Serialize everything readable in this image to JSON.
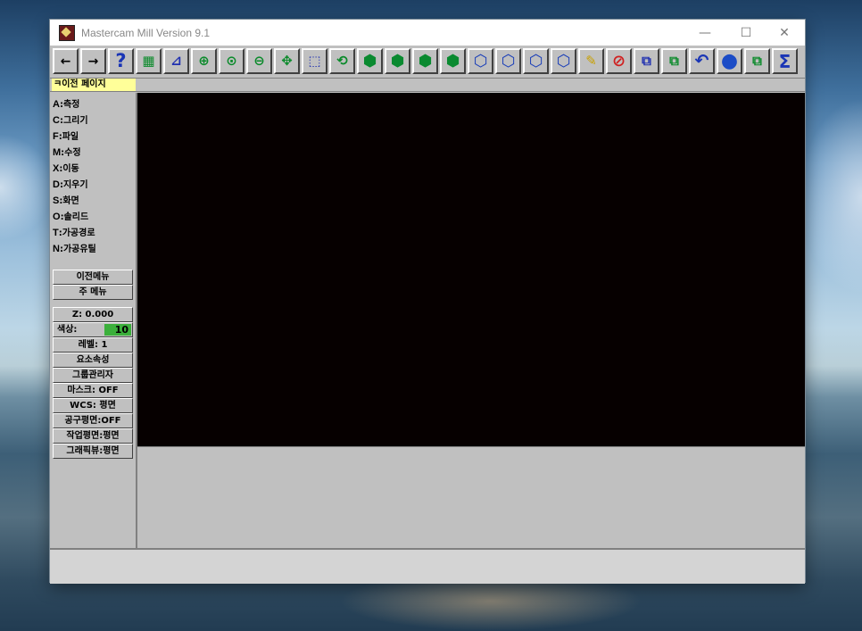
{
  "window": {
    "title": "Mastercam Mill Version 9.1"
  },
  "window_controls": {
    "minimize": "—",
    "maximize": "☐",
    "close": "✕"
  },
  "toolbar": {
    "buttons": [
      {
        "name": "back-arrow-icon",
        "glyph": "←"
      },
      {
        "name": "forward-arrow-icon",
        "glyph": "→"
      },
      {
        "name": "help-icon",
        "glyph": "?"
      },
      {
        "name": "calculator-icon",
        "glyph": "▦"
      },
      {
        "name": "analyze-icon",
        "glyph": "⊿"
      },
      {
        "name": "zoom-window-icon",
        "glyph": "⊕"
      },
      {
        "name": "zoom-in-icon",
        "glyph": "⊙"
      },
      {
        "name": "zoom-out-icon",
        "glyph": "⊖"
      },
      {
        "name": "pan-icon",
        "glyph": "✥"
      },
      {
        "name": "fit-screen-icon",
        "glyph": "⬚"
      },
      {
        "name": "rotate-view-icon",
        "glyph": "⟲"
      },
      {
        "name": "view-top-icon",
        "glyph": "⬢"
      },
      {
        "name": "view-front-icon",
        "glyph": "⬢"
      },
      {
        "name": "view-side-icon",
        "glyph": "⬢"
      },
      {
        "name": "view-iso-icon",
        "glyph": "⬢"
      },
      {
        "name": "cplane-top-icon",
        "glyph": "⬡"
      },
      {
        "name": "cplane-front-icon",
        "glyph": "⬡"
      },
      {
        "name": "cplane-side-icon",
        "glyph": "⬡"
      },
      {
        "name": "cplane-3d-icon",
        "glyph": "⬡"
      },
      {
        "name": "sketch-pencil-icon",
        "glyph": "✎"
      },
      {
        "name": "clear-color-icon",
        "glyph": "⊘"
      },
      {
        "name": "copy-view-icon",
        "glyph": "⧉"
      },
      {
        "name": "transform-icon",
        "glyph": "⧉"
      },
      {
        "name": "undo-icon",
        "glyph": "↶"
      },
      {
        "name": "shade-sphere-icon",
        "glyph": "●"
      },
      {
        "name": "layers-icon",
        "glyph": "⧉"
      },
      {
        "name": "sigma-icon",
        "glyph": "Σ"
      }
    ]
  },
  "prompt": {
    "text": "ㅋ이전 페이지"
  },
  "menu": {
    "items": [
      {
        "key": "A",
        "label": ":측정"
      },
      {
        "key": "C",
        "label": ":그리기"
      },
      {
        "key": "F",
        "label": ":파일"
      },
      {
        "key": "M",
        "label": ":수정"
      },
      {
        "key": "X",
        "label": ":이동"
      },
      {
        "key": "D",
        "label": ":지우기"
      },
      {
        "key": "S",
        "label": ":화면"
      },
      {
        "key": "O",
        "label": ":솔리드"
      },
      {
        "key": "T",
        "label": ":가공경로"
      },
      {
        "key": "N",
        "label": ":가공유틸"
      }
    ],
    "prev_menu": "이전메뉴",
    "main_menu": "주 메뉴"
  },
  "secondary": {
    "z": "Z:  0.000",
    "color_label": "색상:",
    "color_value": "10",
    "level": "레벨:  1",
    "attributes": "요소속성",
    "groups": "그룹관리자",
    "mask": "마스크:  OFF",
    "wcs": "WCS: 평면",
    "tplane": "공구평면:OFF",
    "cplane": "작업평면:평면",
    "gview": "그래픽뷰:평면"
  },
  "colors": {
    "color_swatch": "#3bb03b",
    "prompt_bg": "#ffff99",
    "viewport_bg": "#060000"
  }
}
